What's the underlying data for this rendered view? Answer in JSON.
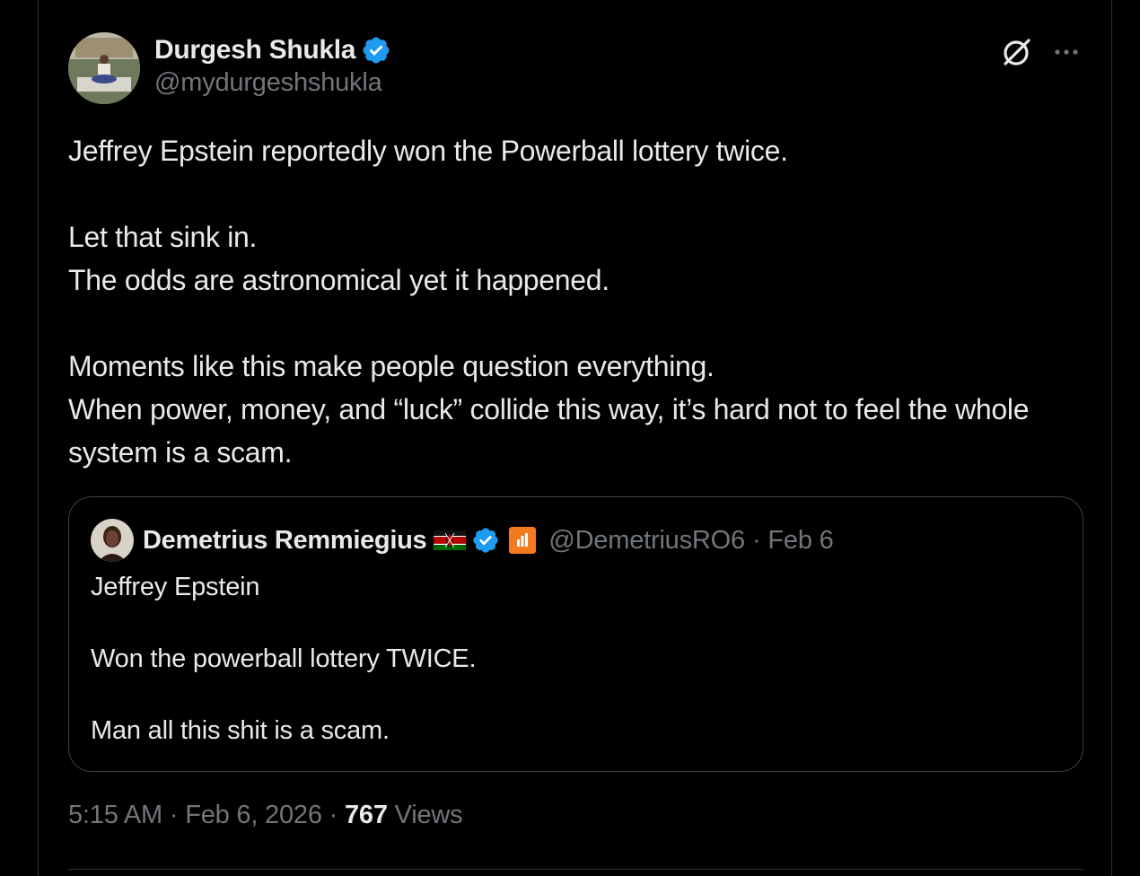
{
  "author": {
    "display_name": "Durgesh Shukla",
    "handle": "@mydurgeshshukla",
    "verified_icon": "verified-badge-icon"
  },
  "header_actions": {
    "grok_icon": "grok-icon",
    "more_icon": "more-horizontal-icon"
  },
  "tweet": {
    "lines": [
      "Jeffrey Epstein reportedly won the Powerball lottery twice.",
      "Let that sink in.",
      "The odds are astronomical yet it happened.",
      "Moments like this make people question everything.",
      "When power, money, and “luck” collide this way, it’s hard not to feel the whole system is a scam."
    ]
  },
  "quoted_tweet": {
    "display_name": "Demetrius Remmiegius",
    "flag_icon": "kenya-flag-icon",
    "verified_icon": "verified-badge-icon",
    "affiliate_icon": "affiliate-badge-icon",
    "handle": "@DemetriusRO6",
    "separator": "·",
    "date": "Feb 6",
    "lines": [
      "Jeffrey Epstein",
      "Won the powerball lottery TWICE.",
      "Man all this shit is a scam."
    ]
  },
  "meta": {
    "time": "5:15 AM",
    "separator": "·",
    "date": "Feb 6, 2026",
    "views_count": "767",
    "views_label": "Views"
  },
  "colors": {
    "background": "#000000",
    "text": "#e7e9ea",
    "secondary": "#71767b",
    "verified": "#1d9bf0",
    "border": "#2f3336"
  }
}
